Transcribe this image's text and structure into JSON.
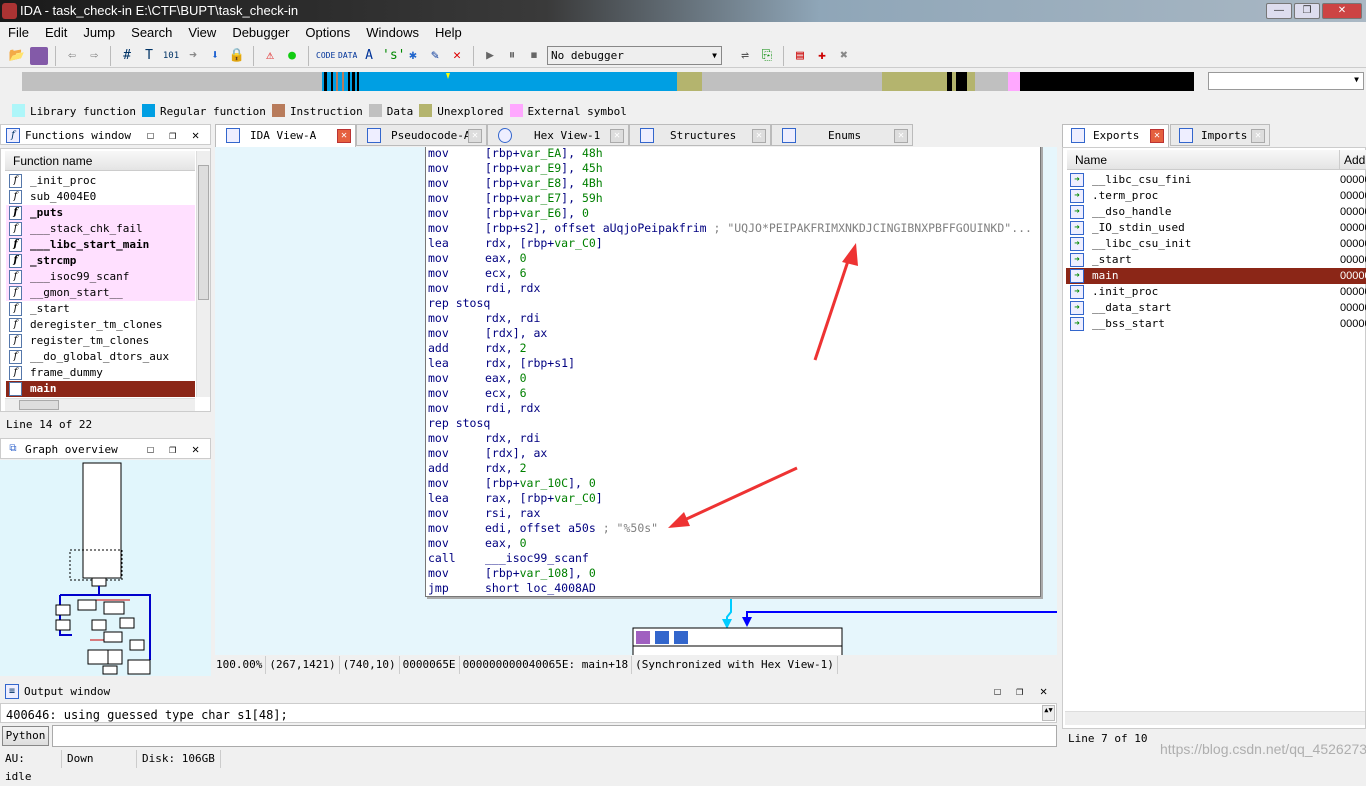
{
  "window": {
    "title": "IDA - task_check-in E:\\CTF\\BUPT\\task_check-in",
    "controls": [
      "—",
      "❐",
      "✕"
    ]
  },
  "menu": [
    "File",
    "Edit",
    "Jump",
    "Search",
    "View",
    "Debugger",
    "Options",
    "Windows",
    "Help"
  ],
  "toolbar": {
    "debugger_select": "No debugger"
  },
  "legend": [
    {
      "label": "Library function",
      "color": "#aef6f9"
    },
    {
      "label": "Regular function",
      "color": "#009fe3"
    },
    {
      "label": "Instruction",
      "color": "#b87b5b"
    },
    {
      "label": "Data",
      "color": "#c0c0c0"
    },
    {
      "label": "Unexplored",
      "color": "#b4b46e"
    },
    {
      "label": "External symbol",
      "color": "#ffa8ff"
    }
  ],
  "functions_window": {
    "title": "Functions window",
    "column": "Function name",
    "items": [
      {
        "name": "_init_proc",
        "style": ""
      },
      {
        "name": "sub_4004E0",
        "style": ""
      },
      {
        "name": "_puts",
        "style": "pink bold"
      },
      {
        "name": "___stack_chk_fail",
        "style": "pink"
      },
      {
        "name": "___libc_start_main",
        "style": "pink bold"
      },
      {
        "name": "_strcmp",
        "style": "pink bold"
      },
      {
        "name": "___isoc99_scanf",
        "style": "pink"
      },
      {
        "name": "__gmon_start__",
        "style": "pink"
      },
      {
        "name": "_start",
        "style": ""
      },
      {
        "name": "deregister_tm_clones",
        "style": ""
      },
      {
        "name": "register_tm_clones",
        "style": ""
      },
      {
        "name": "__do_global_dtors_aux",
        "style": ""
      },
      {
        "name": "frame_dummy",
        "style": ""
      },
      {
        "name": "main",
        "style": "sel"
      }
    ],
    "line_status": "Line 14 of 22"
  },
  "graph_overview": {
    "title": "Graph overview"
  },
  "tabs": [
    {
      "label": "IDA View-A",
      "active": true
    },
    {
      "label": "Pseudocode-A"
    },
    {
      "label": "Hex View-1"
    },
    {
      "label": "Structures"
    },
    {
      "label": "Enums"
    }
  ],
  "code": [
    {
      "m": "mov",
      "o": [
        [
          "[rbp+",
          "n"
        ],
        [
          "var_EA",
          "g"
        ],
        [
          "], ",
          "n"
        ],
        [
          "48h",
          "g"
        ]
      ]
    },
    {
      "m": "mov",
      "o": [
        [
          "[rbp+",
          "n"
        ],
        [
          "var_E9",
          "g"
        ],
        [
          "], ",
          "n"
        ],
        [
          "45h",
          "g"
        ]
      ]
    },
    {
      "m": "mov",
      "o": [
        [
          "[rbp+",
          "n"
        ],
        [
          "var_E8",
          "g"
        ],
        [
          "], ",
          "n"
        ],
        [
          "4Bh",
          "g"
        ]
      ]
    },
    {
      "m": "mov",
      "o": [
        [
          "[rbp+",
          "n"
        ],
        [
          "var_E7",
          "g"
        ],
        [
          "], ",
          "n"
        ],
        [
          "59h",
          "g"
        ]
      ]
    },
    {
      "m": "mov",
      "o": [
        [
          "[rbp+",
          "n"
        ],
        [
          "var_E6",
          "g"
        ],
        [
          "], ",
          "n"
        ],
        [
          "0",
          "g"
        ]
      ]
    },
    {
      "m": "mov",
      "o": [
        [
          "[rbp+s2], offset aUqjoPeipakfrim",
          "n"
        ],
        [
          " ; \"UQJO*PEIPAKFRIMXNKDJCINGIBNXPBFFGOUINKD\"...",
          "c"
        ]
      ]
    },
    {
      "m": "lea",
      "o": [
        [
          "rdx, [rbp+",
          "n"
        ],
        [
          "var_C0",
          "g"
        ],
        [
          "]",
          "n"
        ]
      ]
    },
    {
      "m": "mov",
      "o": [
        [
          "eax, ",
          "n"
        ],
        [
          "0",
          "g"
        ]
      ]
    },
    {
      "m": "mov",
      "o": [
        [
          "ecx, ",
          "n"
        ],
        [
          "6",
          "g"
        ]
      ]
    },
    {
      "m": "mov",
      "o": [
        [
          "rdi, rdx",
          "n"
        ]
      ]
    },
    {
      "m": "rep stosq",
      "o": []
    },
    {
      "m": "mov",
      "o": [
        [
          "rdx, rdi",
          "n"
        ]
      ]
    },
    {
      "m": "mov",
      "o": [
        [
          "[rdx], ax",
          "n"
        ]
      ]
    },
    {
      "m": "add",
      "o": [
        [
          "rdx, ",
          "n"
        ],
        [
          "2",
          "g"
        ]
      ]
    },
    {
      "m": "lea",
      "o": [
        [
          "rdx, [rbp+s1]",
          "n"
        ]
      ]
    },
    {
      "m": "mov",
      "o": [
        [
          "eax, ",
          "n"
        ],
        [
          "0",
          "g"
        ]
      ]
    },
    {
      "m": "mov",
      "o": [
        [
          "ecx, ",
          "n"
        ],
        [
          "6",
          "g"
        ]
      ]
    },
    {
      "m": "mov",
      "o": [
        [
          "rdi, rdx",
          "n"
        ]
      ]
    },
    {
      "m": "rep stosq",
      "o": []
    },
    {
      "m": "mov",
      "o": [
        [
          "rdx, rdi",
          "n"
        ]
      ]
    },
    {
      "m": "mov",
      "o": [
        [
          "[rdx], ax",
          "n"
        ]
      ]
    },
    {
      "m": "add",
      "o": [
        [
          "rdx, ",
          "n"
        ],
        [
          "2",
          "g"
        ]
      ]
    },
    {
      "m": "mov",
      "o": [
        [
          "[rbp+",
          "n"
        ],
        [
          "var_10C",
          "g"
        ],
        [
          "], ",
          "n"
        ],
        [
          "0",
          "g"
        ]
      ]
    },
    {
      "m": "lea",
      "o": [
        [
          "rax, [rbp+",
          "n"
        ],
        [
          "var_C0",
          "g"
        ],
        [
          "]",
          "n"
        ]
      ]
    },
    {
      "m": "mov",
      "o": [
        [
          "rsi, rax",
          "n"
        ]
      ]
    },
    {
      "m": "mov",
      "o": [
        [
          "edi, offset a50s",
          "n"
        ],
        [
          " ; \"%50s\"",
          "c"
        ]
      ]
    },
    {
      "m": "mov",
      "o": [
        [
          "eax, ",
          "n"
        ],
        [
          "0",
          "g"
        ]
      ]
    },
    {
      "m": "call",
      "o": [
        [
          "___isoc99_scanf",
          "n"
        ]
      ]
    },
    {
      "m": "mov",
      "o": [
        [
          "[rbp+",
          "n"
        ],
        [
          "var_108",
          "g"
        ],
        [
          "], ",
          "n"
        ],
        [
          "0",
          "g"
        ]
      ]
    },
    {
      "m": "jmp",
      "o": [
        [
          "short loc_4008AD",
          "n"
        ]
      ]
    }
  ],
  "view_status": [
    "100.00%",
    "(267,1421)",
    "(740,10)",
    "0000065E",
    "000000000040065E: main+18",
    "(Synchronized with Hex View-1)"
  ],
  "output_window": {
    "title": "Output window",
    "text": "400646: using guessed type char s1[48];",
    "python_button": "Python"
  },
  "statusbar": [
    "AU:  idle",
    "Down",
    "Disk: 106GB"
  ],
  "exports": {
    "tabs": [
      "Exports",
      "Imports"
    ],
    "columns": [
      "Name",
      "Addr"
    ],
    "items": [
      {
        "name": "__libc_csu_fini",
        "addr": "00000"
      },
      {
        "name": ".term_proc",
        "addr": "00000"
      },
      {
        "name": "__dso_handle",
        "addr": "00000"
      },
      {
        "name": "_IO_stdin_used",
        "addr": "00000"
      },
      {
        "name": "__libc_csu_init",
        "addr": "00000"
      },
      {
        "name": "_start",
        "addr": "00000"
      },
      {
        "name": "main",
        "addr": "00000",
        "selected": true
      },
      {
        "name": ".init_proc",
        "addr": "00000"
      },
      {
        "name": "__data_start",
        "addr": "00000"
      },
      {
        "name": "__bss_start",
        "addr": "00000"
      }
    ],
    "line_status": "Line 7 of 10"
  },
  "watermark": "https://blog.csdn.net/qq_45262739"
}
